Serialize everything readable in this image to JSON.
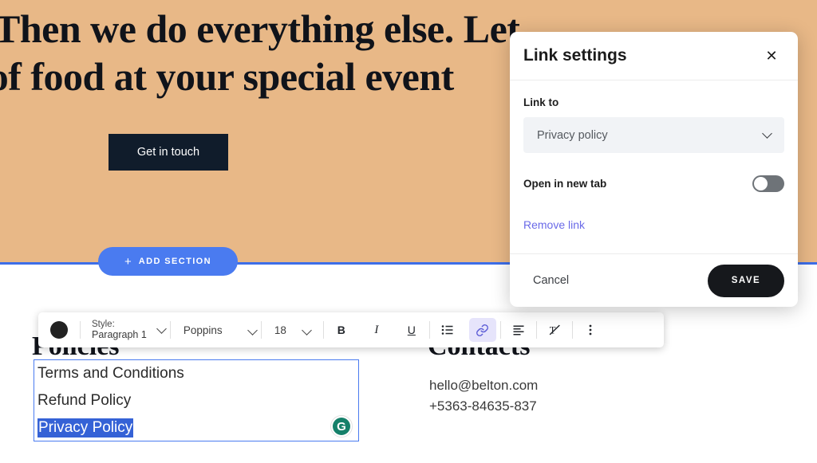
{
  "hero": {
    "headline_line1": "Then we do everything else. Let",
    "headline_line2": "e of food at your special event",
    "cta_label": "Get in touch",
    "background_color": "#e8b887",
    "cta_background_color": "#101c2b"
  },
  "canvas": {
    "add_section_label": "ADD SECTION",
    "add_section_plus": "+",
    "divider_color": "#3d6ee8",
    "add_section_color": "#4a7bf0"
  },
  "footer": {
    "policies_heading": "Policies",
    "contacts_heading": "Contacts",
    "policy_links": [
      "Terms and Conditions",
      "Refund Policy",
      "Privacy Policy"
    ],
    "selected_policy_link": "Privacy Policy",
    "selection_color": "#3562d6",
    "textbox_border_color": "#4a7bf0",
    "contacts": [
      "hello@belton.com",
      "+5363-84635-837"
    ],
    "grammarly_glyph": "G",
    "grammarly_color": "#15806a"
  },
  "toolbar": {
    "color_swatch": "#222222",
    "style_label": "Style:",
    "style_value": "Paragraph 1",
    "font_family_value": "Poppins",
    "font_size_value": "18",
    "bold_glyph": "B",
    "italic_glyph": "I",
    "underline_glyph": "U",
    "buttons": [
      {
        "name": "bold",
        "label": "B"
      },
      {
        "name": "italic",
        "label": "I"
      },
      {
        "name": "underline",
        "label": "U"
      },
      {
        "name": "bulleted-list",
        "label": ""
      },
      {
        "name": "link",
        "label": "",
        "active": true
      },
      {
        "name": "align",
        "label": ""
      },
      {
        "name": "clear-formatting",
        "label": ""
      },
      {
        "name": "more-options",
        "label": ""
      }
    ],
    "active_button": "link",
    "active_highlight_color": "#e6e4fb",
    "active_icon_color": "#5b5bd6"
  },
  "dialog": {
    "title": "Link settings",
    "close_glyph": "✕",
    "link_to_label": "Link to",
    "link_to_value": "Privacy policy",
    "open_new_tab_label": "Open in new tab",
    "open_new_tab_state": "off",
    "remove_link_label": "Remove link",
    "remove_link_color": "#6a6ae8",
    "cancel_label": "Cancel",
    "save_label": "SAVE",
    "save_background_color": "#16181c"
  }
}
